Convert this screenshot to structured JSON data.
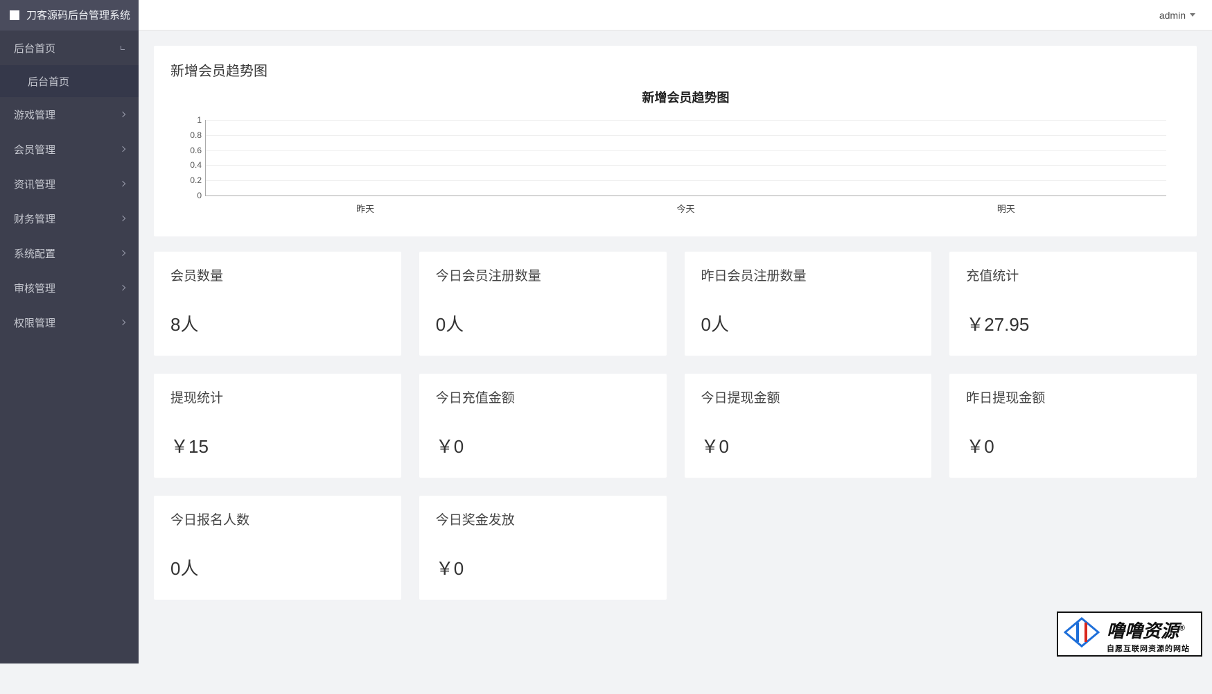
{
  "brand": "刀客源码后台管理系统",
  "user": {
    "name": "admin"
  },
  "sidebar": {
    "items": [
      {
        "label": "后台首页",
        "expanded": true,
        "children": [
          {
            "label": "后台首页"
          }
        ]
      },
      {
        "label": "游戏管理"
      },
      {
        "label": "会员管理"
      },
      {
        "label": "资讯管理"
      },
      {
        "label": "财务管理"
      },
      {
        "label": "系统配置"
      },
      {
        "label": "审核管理"
      },
      {
        "label": "权限管理"
      }
    ]
  },
  "chart_card_title": "新增会员趋势图",
  "chart_data": {
    "type": "line",
    "title": "新增会员趋势图",
    "categories": [
      "昨天",
      "今天",
      "明天"
    ],
    "values": [
      0,
      0,
      0
    ],
    "ylim": [
      0,
      1
    ],
    "yticks": [
      0,
      0.2,
      0.4,
      0.6,
      0.8,
      1
    ],
    "xlabel": "",
    "ylabel": ""
  },
  "stats": [
    {
      "label": "会员数量",
      "value": "8人"
    },
    {
      "label": "今日会员注册数量",
      "value": "0人"
    },
    {
      "label": "昨日会员注册数量",
      "value": "0人"
    },
    {
      "label": "充值统计",
      "value": "￥27.95"
    },
    {
      "label": "提现统计",
      "value": "￥15"
    },
    {
      "label": "今日充值金额",
      "value": "￥0"
    },
    {
      "label": "今日提现金额",
      "value": "￥0"
    },
    {
      "label": "昨日提现金额",
      "value": "￥0"
    },
    {
      "label": "今日报名人数",
      "value": "0人"
    },
    {
      "label": "今日奖金发放",
      "value": "￥0"
    }
  ],
  "watermark": {
    "text": "噜噜资源",
    "reg": "®",
    "sub": "自愿互联网资源的网站"
  }
}
